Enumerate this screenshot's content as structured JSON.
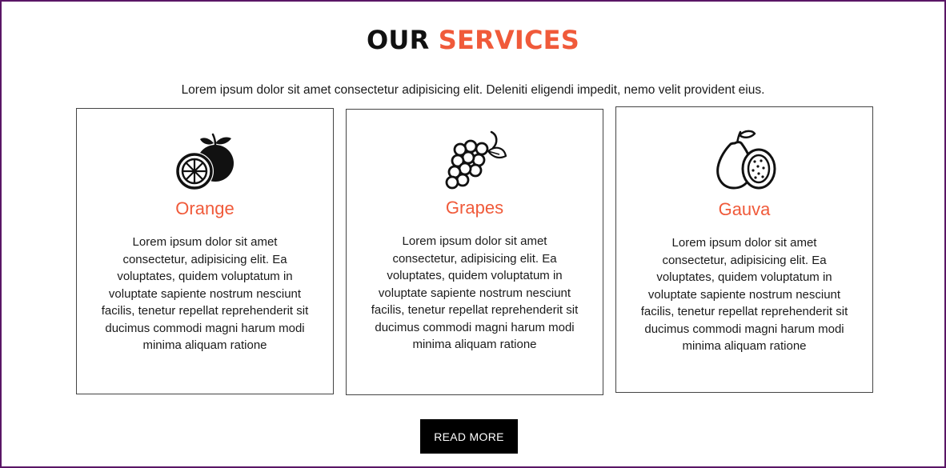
{
  "header": {
    "title_part1": "OUR",
    "title_part2": "SERVICES",
    "subtitle": "Lorem ipsum dolor sit amet consectetur adipisicing elit. Deleniti eligendi impedit, nemo velit provident eius."
  },
  "cards": [
    {
      "icon": "orange-icon",
      "title": "Orange",
      "text": "Lorem ipsum dolor sit amet consectetur, adipisicing elit. Ea voluptates, quidem voluptatum in voluptate sapiente nostrum nesciunt facilis, tenetur repellat reprehenderit sit ducimus commodi magni harum modi minima aliquam ratione"
    },
    {
      "icon": "grapes-icon",
      "title": "Grapes",
      "text": "Lorem ipsum dolor sit amet consectetur, adipisicing elit. Ea voluptates, quidem voluptatum in voluptate sapiente nostrum nesciunt facilis, tenetur repellat reprehenderit sit ducimus commodi magni harum modi minima aliquam ratione"
    },
    {
      "icon": "guava-icon",
      "title": "Gauva",
      "text": "Lorem ipsum dolor sit amet consectetur, adipisicing elit. Ea voluptates, quidem voluptatum in voluptate sapiente nostrum nesciunt facilis, tenetur repellat reprehenderit sit ducimus commodi magni harum modi minima aliquam ratione"
    }
  ],
  "cta": {
    "label": "READ MORE"
  },
  "colors": {
    "accent": "#f05a3a",
    "text": "#111111",
    "button_bg": "#000000",
    "button_text": "#ffffff",
    "frame_border": "#5a1666"
  }
}
